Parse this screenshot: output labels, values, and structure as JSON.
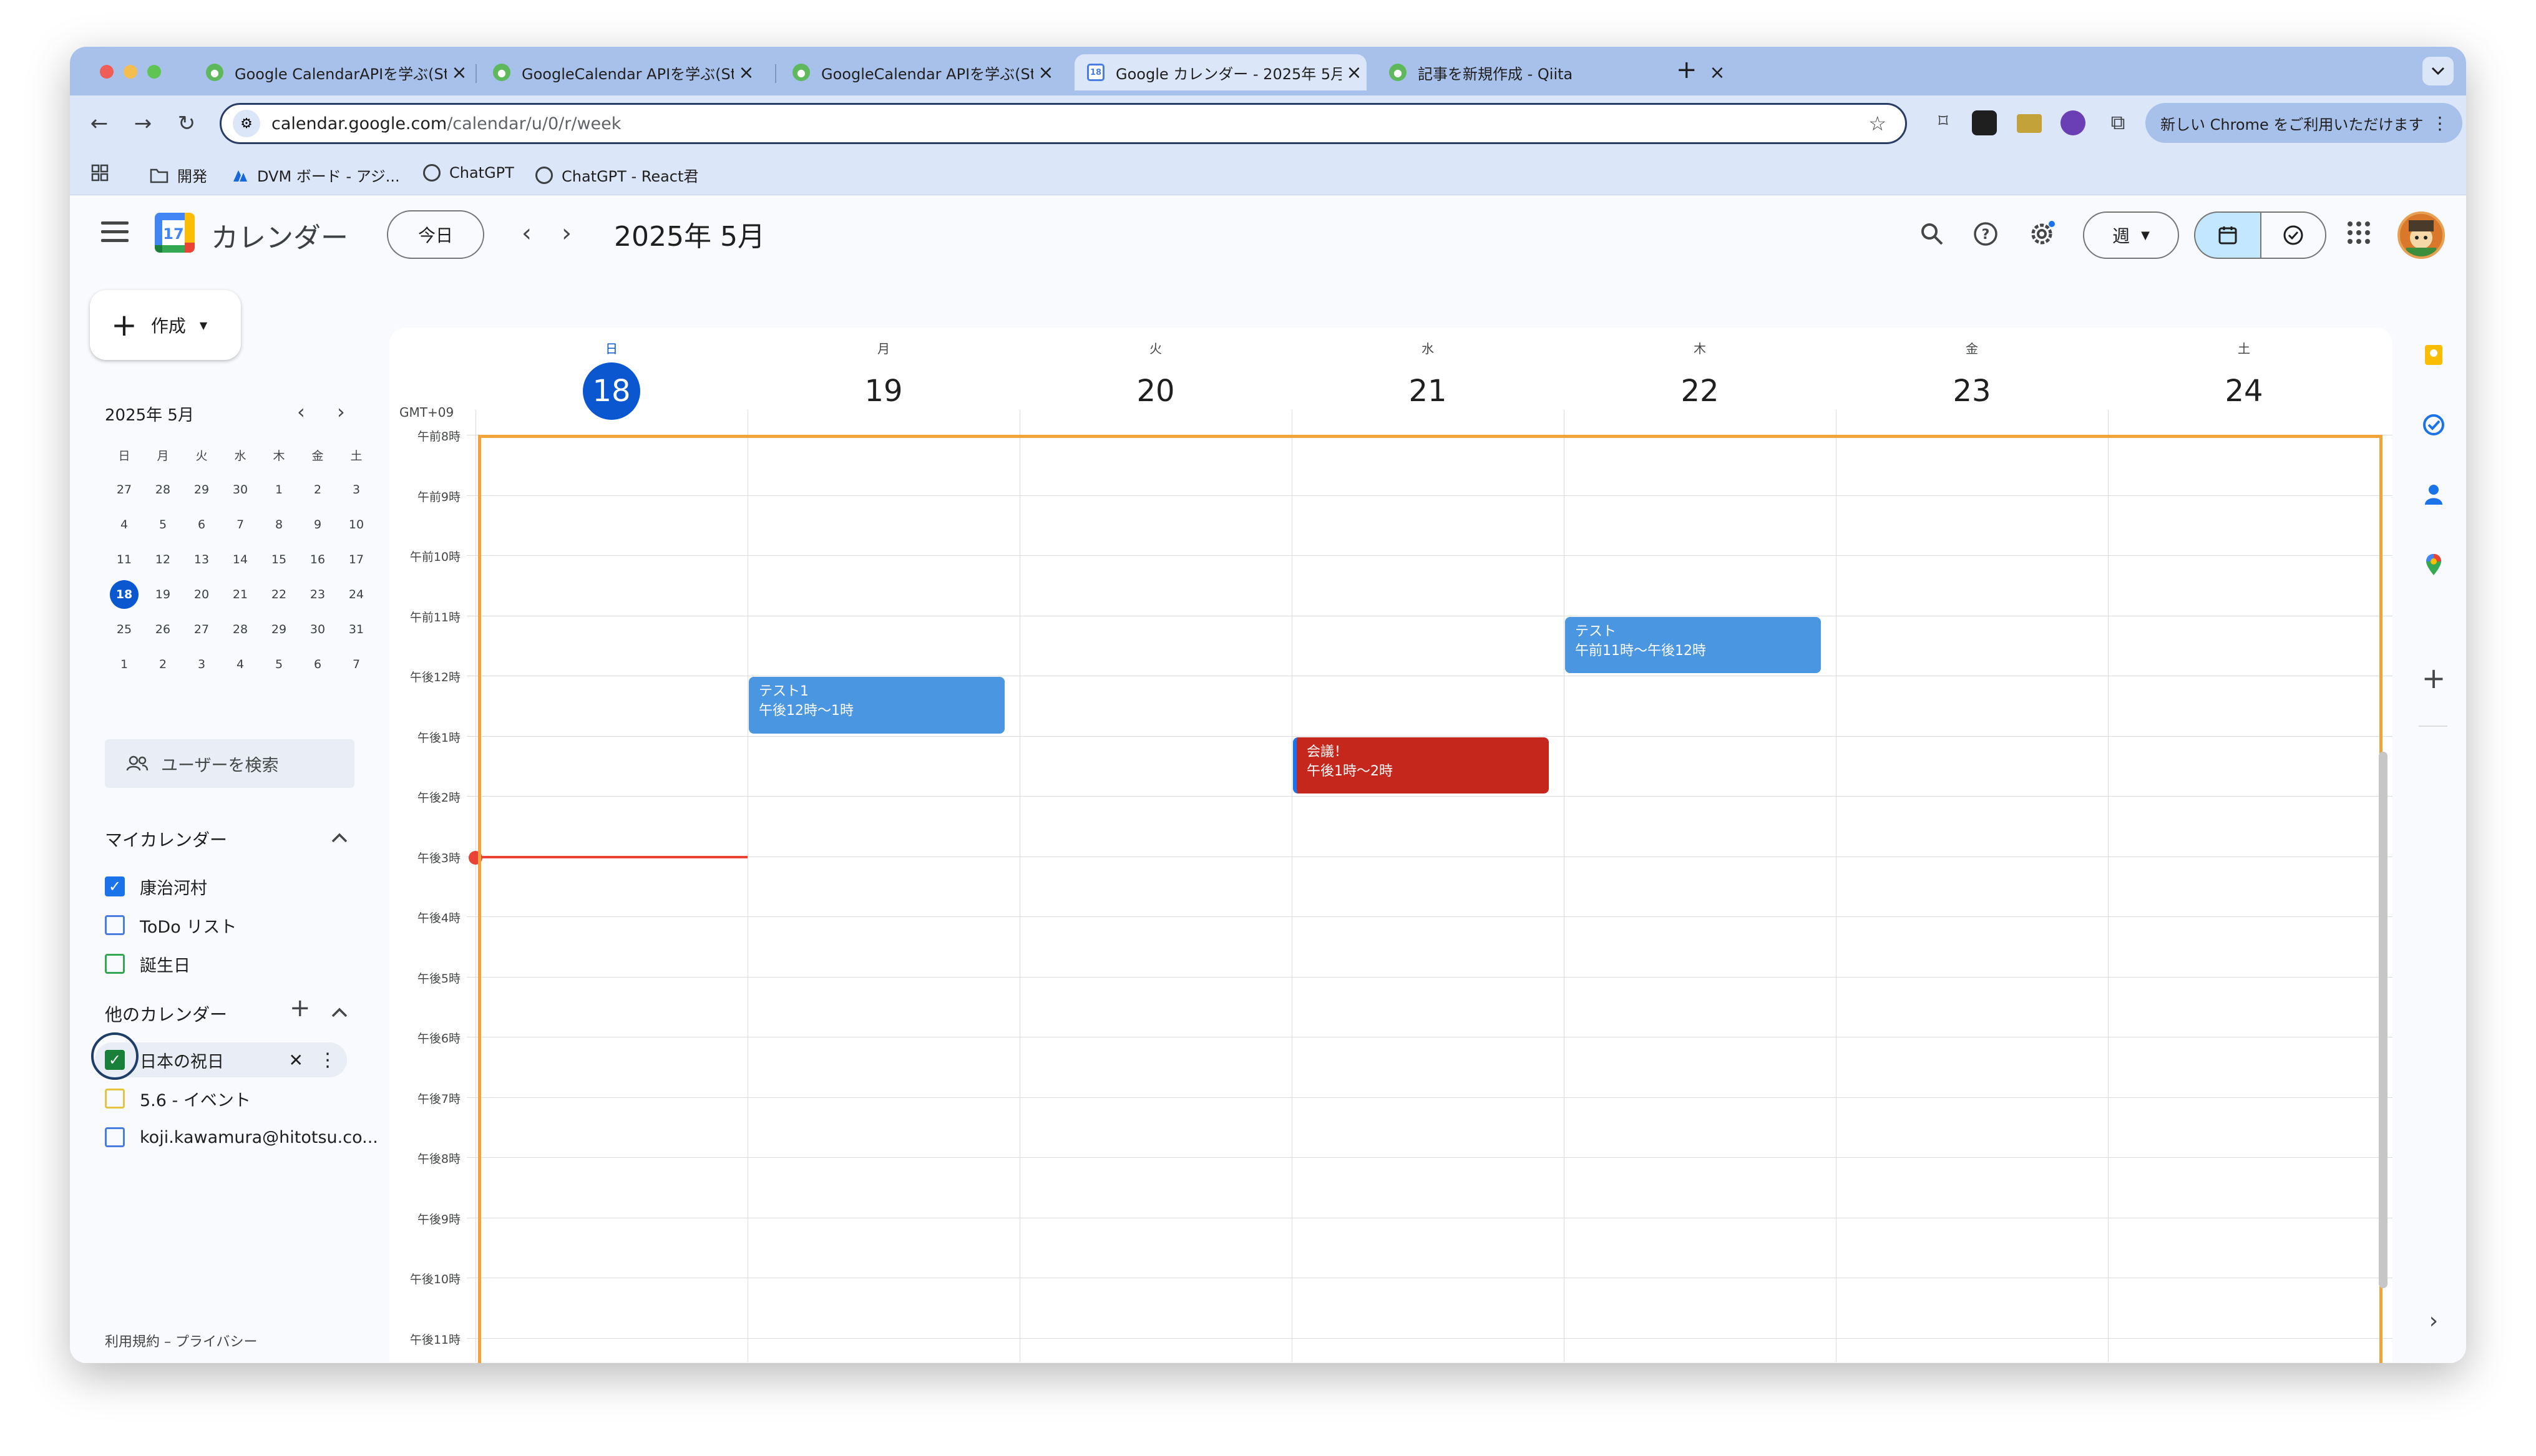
{
  "browser": {
    "tabs": [
      {
        "title": "Google CalendarAPIを学ぶ(St"
      },
      {
        "title": "GoogleCalendar APIを学ぶ(St"
      },
      {
        "title": "GoogleCalendar APIを学ぶ(St"
      },
      {
        "title": "Google カレンダー - 2025年 5月"
      },
      {
        "title": "記事を新規作成 - Qiita"
      }
    ],
    "tab_close": "×",
    "new_tab": "+",
    "url_host": "calendar.google.com",
    "url_path": "/calendar/u/0/r/week",
    "promo": "新しい Chrome をご利用いただけます",
    "bookmarks": [
      "開発",
      "DVM ボード - アジ...",
      "ChatGPT",
      "ChatGPT - React君"
    ]
  },
  "header": {
    "app_title": "カレンダー",
    "logo_day": "17",
    "today_label": "今日",
    "month_label": "2025年 5月",
    "view_label": "週"
  },
  "sidebar": {
    "create_label": "作成",
    "mini_title": "2025年 5月",
    "weekdays": [
      "日",
      "月",
      "火",
      "水",
      "木",
      "金",
      "土"
    ],
    "mini_days": [
      "27",
      "28",
      "29",
      "30",
      "1",
      "2",
      "3",
      "4",
      "5",
      "6",
      "7",
      "8",
      "9",
      "10",
      "11",
      "12",
      "13",
      "14",
      "15",
      "16",
      "17",
      "18",
      "19",
      "20",
      "21",
      "22",
      "23",
      "24",
      "25",
      "26",
      "27",
      "28",
      "29",
      "30",
      "31",
      "1",
      "2",
      "3",
      "4",
      "5",
      "6",
      "7"
    ],
    "mini_today_index": 21,
    "people_search": "ユーザーを検索",
    "my_calendars_title": "マイカレンダー",
    "my_calendars": [
      {
        "name": "康治河村",
        "color": "#1a73e8",
        "checked": true
      },
      {
        "name": "ToDo リスト",
        "color": "#4a7de2",
        "checked": false
      },
      {
        "name": "誕生日",
        "color": "#33a853",
        "checked": false
      }
    ],
    "other_calendars_title": "他のカレンダー",
    "other_calendars": [
      {
        "name": "日本の祝日",
        "color": "#188038",
        "checked": true
      },
      {
        "name": "5.6 - イベント",
        "color": "#e4c441",
        "checked": false
      },
      {
        "name": "koji.kawamura@hitotsu.co...",
        "color": "#4a7de2",
        "checked": false
      }
    ],
    "footer": "利用規約 – プライバシー"
  },
  "week": {
    "timezone": "GMT+09",
    "days": [
      {
        "dow": "日",
        "num": "18",
        "today": true
      },
      {
        "dow": "月",
        "num": "19"
      },
      {
        "dow": "火",
        "num": "20"
      },
      {
        "dow": "水",
        "num": "21"
      },
      {
        "dow": "木",
        "num": "22"
      },
      {
        "dow": "金",
        "num": "23"
      },
      {
        "dow": "土",
        "num": "24"
      }
    ],
    "hours": [
      "午前8時",
      "午前9時",
      "午前10時",
      "午前11時",
      "午後12時",
      "午後1時",
      "午後2時",
      "午後3時",
      "午後4時",
      "午後5時",
      "午後6時",
      "午後7時",
      "午後8時",
      "午後9時",
      "午後10時",
      "午後11時"
    ],
    "events": [
      {
        "title": "テスト1",
        "time": "午後12時～1時",
        "day": 1,
        "start": 12,
        "end": 13,
        "color": "blue"
      },
      {
        "title": "会議！",
        "time": "午後1時～2時",
        "day": 3,
        "start": 13,
        "end": 14,
        "color": "red"
      },
      {
        "title": "テスト",
        "time": "午前11時～午後12時",
        "day": 4,
        "start": 11,
        "end": 12,
        "color": "blue"
      }
    ],
    "now_hour": 15
  }
}
